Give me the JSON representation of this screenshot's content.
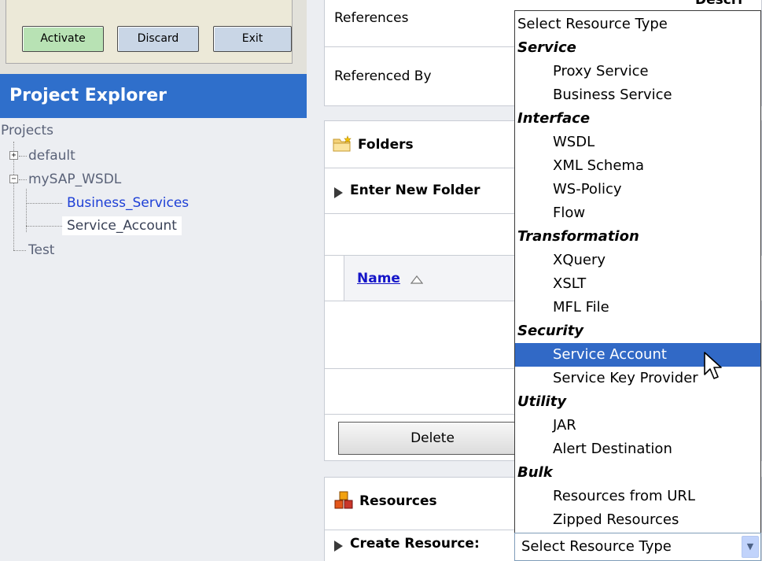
{
  "change_center": {
    "activate_label": "Activate",
    "discard_label": "Discard",
    "exit_label": "Exit"
  },
  "project_explorer": {
    "title": "Project Explorer",
    "root_label": "Projects",
    "nodes": [
      {
        "label": "default"
      },
      {
        "label": "mySAP_WSDL"
      },
      {
        "label": "Business_Services"
      },
      {
        "label": "Service_Account"
      },
      {
        "label": "Test"
      }
    ]
  },
  "main": {
    "references_label": "References",
    "referenced_by_label": "Referenced By",
    "folders_title": "Folders",
    "enter_new_folder_label": "Enter New Folder",
    "name_column_label": "Name",
    "delete_label": "Delete",
    "resources_title": "Resources",
    "create_resource_label": "Create Resource:",
    "top_right_fragment": "Descri"
  },
  "dropdown": {
    "selected_value": "Select Resource Type",
    "highlighted": "Service Account",
    "items": [
      {
        "label": "Select Resource Type",
        "kind": "option"
      },
      {
        "label": "Service",
        "kind": "group"
      },
      {
        "label": "Proxy Service",
        "kind": "option"
      },
      {
        "label": "Business Service",
        "kind": "option"
      },
      {
        "label": "Interface",
        "kind": "group"
      },
      {
        "label": "WSDL",
        "kind": "option"
      },
      {
        "label": "XML Schema",
        "kind": "option"
      },
      {
        "label": "WS-Policy",
        "kind": "option"
      },
      {
        "label": "Flow",
        "kind": "option"
      },
      {
        "label": "Transformation",
        "kind": "group"
      },
      {
        "label": "XQuery",
        "kind": "option"
      },
      {
        "label": "XSLT",
        "kind": "option"
      },
      {
        "label": "MFL File",
        "kind": "option"
      },
      {
        "label": "Security",
        "kind": "group"
      },
      {
        "label": "Service Account",
        "kind": "option"
      },
      {
        "label": "Service Key Provider",
        "kind": "option"
      },
      {
        "label": "Utility",
        "kind": "group"
      },
      {
        "label": "JAR",
        "kind": "option"
      },
      {
        "label": "Alert Destination",
        "kind": "option"
      },
      {
        "label": "Bulk",
        "kind": "group"
      },
      {
        "label": "Resources from URL",
        "kind": "option"
      },
      {
        "label": "Zipped Resources",
        "kind": "option"
      }
    ]
  },
  "colors": {
    "explorer_header": "#2f6fcb",
    "highlight": "#3169c6",
    "link": "#1d3fd6"
  },
  "icons": {
    "folder": "folder-icon",
    "resources": "resources-icon",
    "sort": "sort-ascending-icon",
    "expand": "expand-icon",
    "collapse": "collapse-icon",
    "dropdown_arrow": "chevron-down-icon",
    "cursor": "mouse-pointer-icon"
  }
}
